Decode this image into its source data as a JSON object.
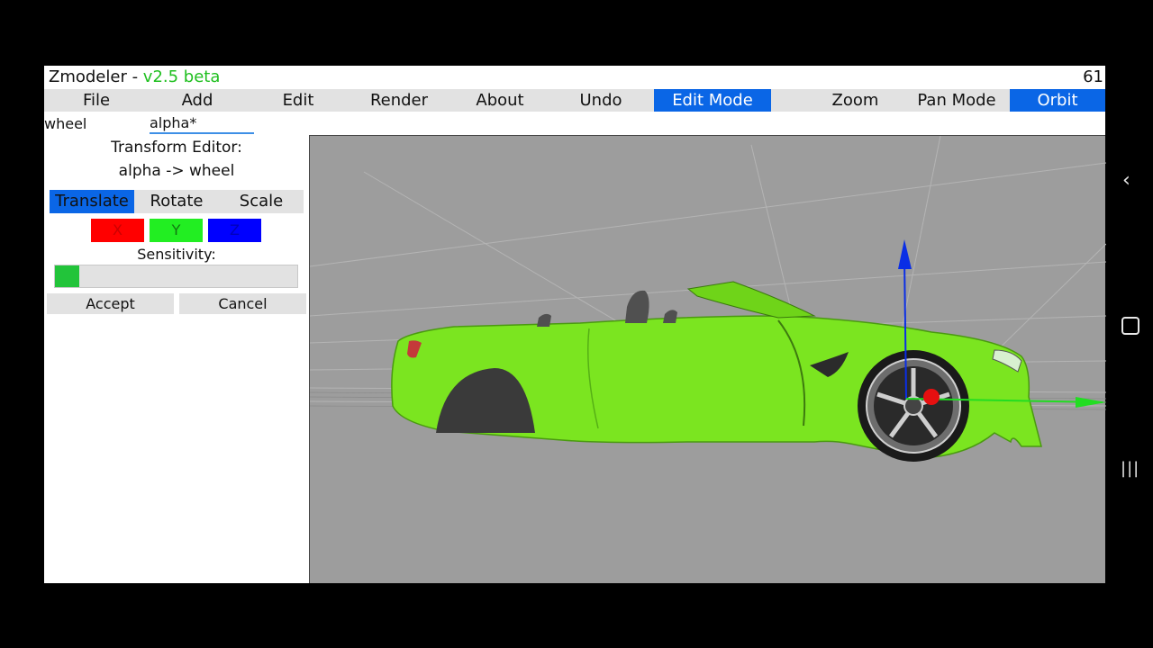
{
  "app": {
    "name": "Zmodeler - ",
    "version": "v2.5 beta",
    "fps": "61"
  },
  "menu": [
    {
      "label": "File",
      "active": false
    },
    {
      "label": "Add",
      "active": false
    },
    {
      "label": "Edit",
      "active": false
    },
    {
      "label": "Render",
      "active": false
    },
    {
      "label": "About",
      "active": false
    },
    {
      "label": "Undo",
      "active": false
    },
    {
      "label": "Edit Mode",
      "active": true
    },
    {
      "label": "",
      "active": false
    },
    {
      "label": "Zoom",
      "active": false
    },
    {
      "label": "Pan Mode",
      "active": false
    },
    {
      "label": "Orbit",
      "active": true
    }
  ],
  "path": {
    "object": "wheel",
    "input_value": "alpha*"
  },
  "editor": {
    "title": "Transform Editor:",
    "subtitle": "alpha -> wheel",
    "tabs": [
      {
        "label": "Translate",
        "active": true
      },
      {
        "label": "Rotate",
        "active": false
      },
      {
        "label": "Scale",
        "active": false
      }
    ],
    "axes": [
      {
        "label": "X",
        "color": "#ff0000",
        "text_color": "#cc0000"
      },
      {
        "label": "Y",
        "color": "#22ee22",
        "text_color": "#117711"
      },
      {
        "label": "Z",
        "color": "#0000ff",
        "text_color": "#0000bb"
      }
    ],
    "sensitivity_label": "Sensitivity:",
    "sensitivity_fraction": 0.1,
    "accept_label": "Accept",
    "cancel_label": "Cancel"
  },
  "viewport": {
    "background": "#9d9d9d",
    "car_color": "#7be520",
    "gizmo": {
      "z_color": "#0a2ee6",
      "x_color": "#e61010",
      "y_color": "#22dd22"
    }
  },
  "android_nav": {
    "back_icon": "back-chevron-icon",
    "home_icon": "home-square-icon",
    "recents_icon": "recents-lines-icon"
  }
}
